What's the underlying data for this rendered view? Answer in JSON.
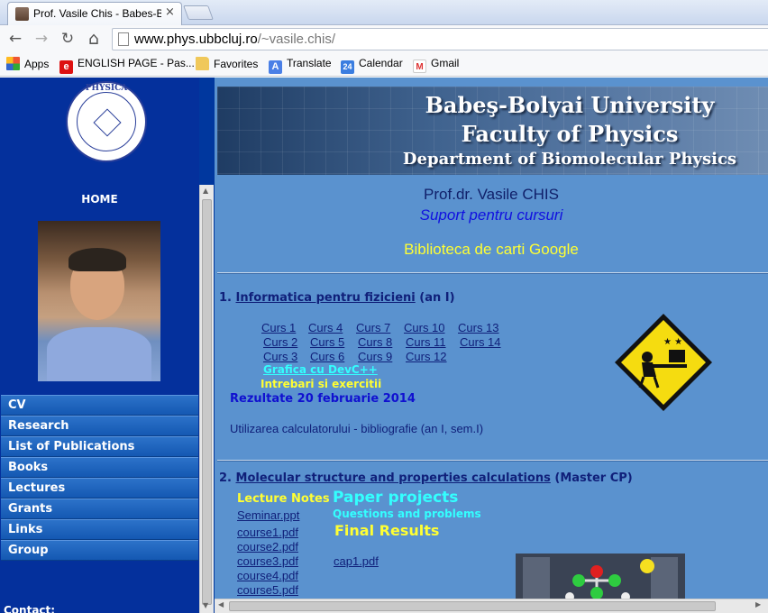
{
  "browser": {
    "tab_title": "Prof. Vasile Chis - Babes-B",
    "tab_close": "×",
    "url_host": "www.phys.ubbcluj.ro",
    "url_path": "/~vasile.chis/",
    "nav": {
      "back": "←",
      "forward": "→",
      "reload": "↻",
      "home": "⌂"
    }
  },
  "bookmarks": [
    {
      "label": "Apps",
      "icon": "apps-grid-icon"
    },
    {
      "label": "ENGLISH PAGE - Pas...",
      "icon": "e-icon",
      "glyph": "e"
    },
    {
      "label": "Favorites",
      "icon": "folder-icon"
    },
    {
      "label": "Translate",
      "icon": "translate-icon",
      "glyph": "A"
    },
    {
      "label": "Calendar",
      "icon": "calendar-icon",
      "glyph": "24"
    },
    {
      "label": "Gmail",
      "icon": "gmail-icon",
      "glyph": "M"
    }
  ],
  "sidebar": {
    "logo_text": "PHYSICA",
    "home": "HOME",
    "menu": [
      "CV",
      "Research",
      "List of Publications",
      "Books",
      "Lectures",
      "Grants",
      "Links",
      "Group"
    ],
    "contact": "Contact:"
  },
  "banner": {
    "line1": "Babeş-Bolyai University",
    "line2": "Faculty of Physics",
    "line3": "Department of Biomolecular Physics"
  },
  "header": {
    "name": "Prof.dr. Vasile CHIS",
    "subtitle": "Suport pentru cursuri",
    "books_link": "Biblioteca de carti Google"
  },
  "section1": {
    "number": "1.",
    "title": "Informatica pentru fizicieni",
    "suffix": "(an I)",
    "courses": [
      [
        "Curs 1",
        "Curs 4",
        "Curs 7",
        "Curs 10",
        "Curs 13"
      ],
      [
        "Curs 2",
        "Curs 5",
        "Curs 8",
        "Curs 11",
        "Curs 14"
      ],
      [
        "Curs 3",
        "Curs 6",
        "Curs 9",
        "Curs 12"
      ]
    ],
    "grafica": "Grafica cu DevC++",
    "intrebari": "Intrebari si exercitii",
    "rezultate": "Rezultate 20 februarie 2014",
    "utilizarea": "Utilizarea calculatorului - bibliografie (an I, sem.I)"
  },
  "section2": {
    "number": "2.",
    "title": "Molecular structure and properties calculations",
    "suffix": "(Master CP)",
    "lecture_notes": "Lecture Notes",
    "paper_projects": "Paper projects",
    "questions": "Questions and problems",
    "final_results": "Final Results",
    "seminar": "Seminar.ppt",
    "courses": [
      "course1.pdf",
      "course2.pdf",
      "course3.pdf",
      "course4.pdf",
      "course5.pdf"
    ],
    "cap1": "cap1.pdf"
  },
  "colors": {
    "sidebar_bg": "#04309c",
    "content_bg": "#5a92cf",
    "link_dark": "#10207a",
    "yellow": "#ffff33",
    "cyan": "#33ffff"
  }
}
